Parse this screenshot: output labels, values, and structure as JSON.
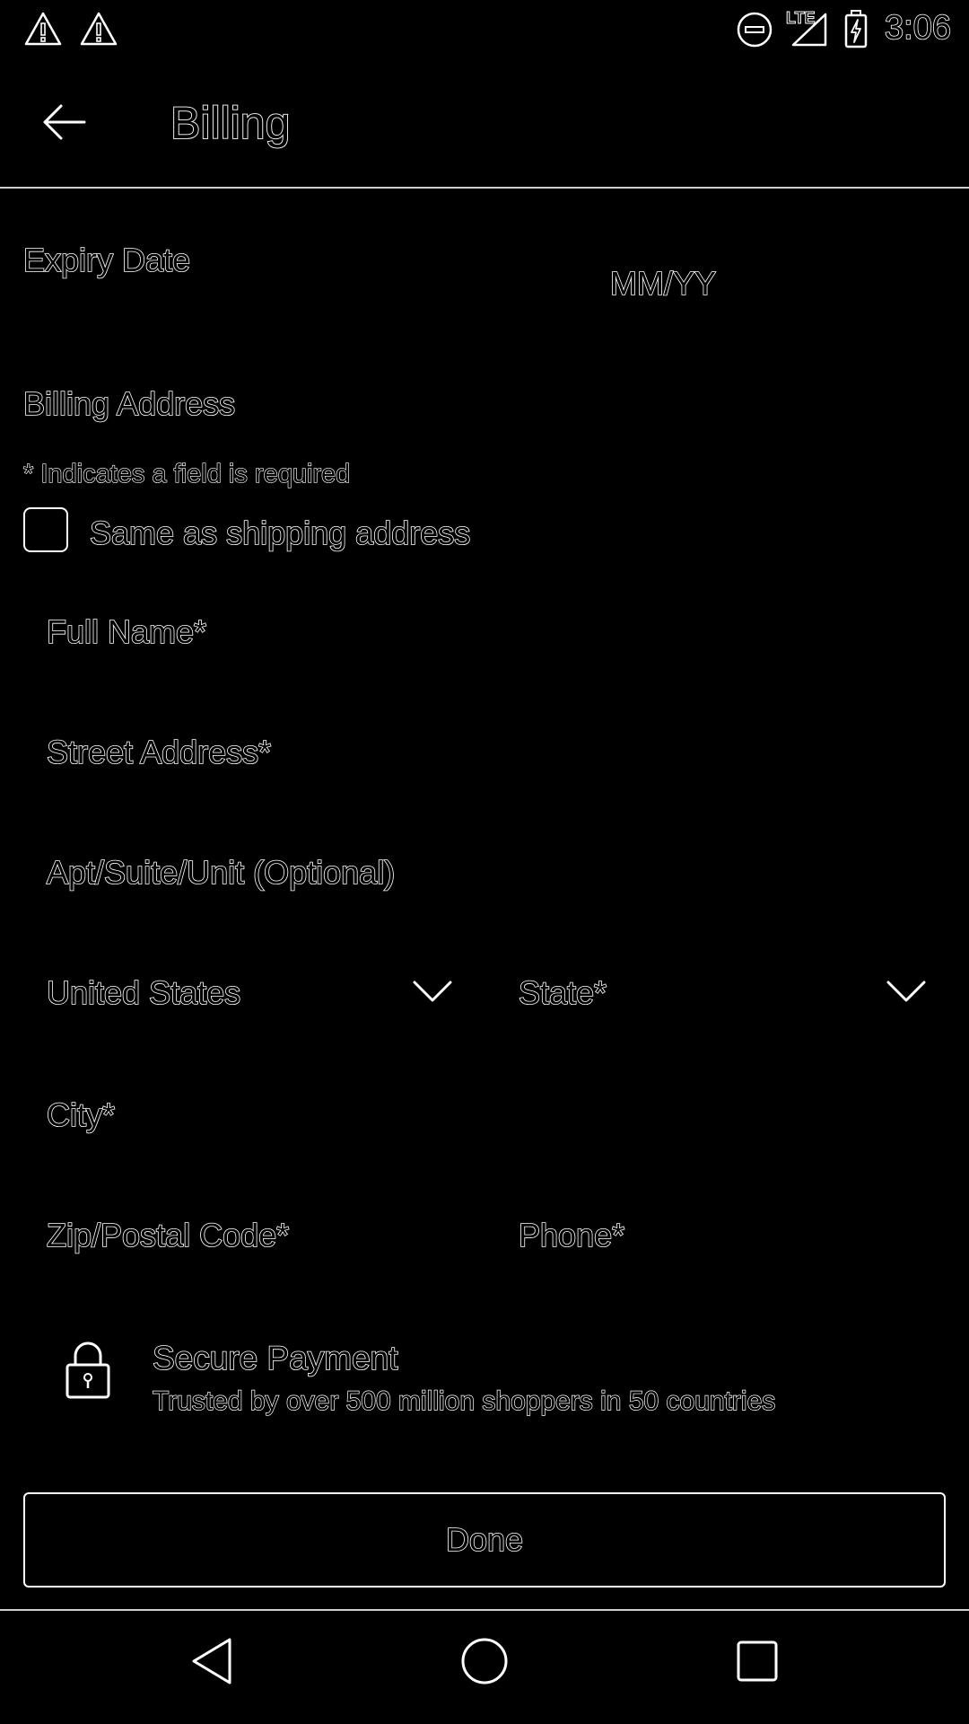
{
  "status_bar": {
    "time": "3:06",
    "network": "LTE",
    "icons": [
      "warning-icon",
      "warning-icon",
      "do-not-disturb-icon",
      "signal-icon",
      "battery-charging-icon"
    ]
  },
  "app_bar": {
    "title": "Billing",
    "back_icon": "arrow-left-icon"
  },
  "expiry": {
    "label": "Expiry Date",
    "placeholder": "MM/YY"
  },
  "billing_address": {
    "heading": "Billing Address",
    "required_note": "* Indicates a field is required",
    "same_as_shipping": {
      "label": "Same as shipping address",
      "checked": false
    }
  },
  "fields": {
    "full_name": "Full Name*",
    "street_address": "Street Address*",
    "apt": "Apt/Suite/Unit (Optional)",
    "country": "United States",
    "state": "State*",
    "city": "City*",
    "zip": "Zip/Postal Code*",
    "phone": "Phone*"
  },
  "secure": {
    "title": "Secure Payment",
    "subtitle": "Trusted by over 500 million shoppers in 50 countries",
    "icon": "lock-icon"
  },
  "done_button": {
    "label": "Done"
  },
  "nav": {
    "back": "nav-back-icon",
    "home": "nav-home-icon",
    "recents": "nav-recents-icon"
  }
}
